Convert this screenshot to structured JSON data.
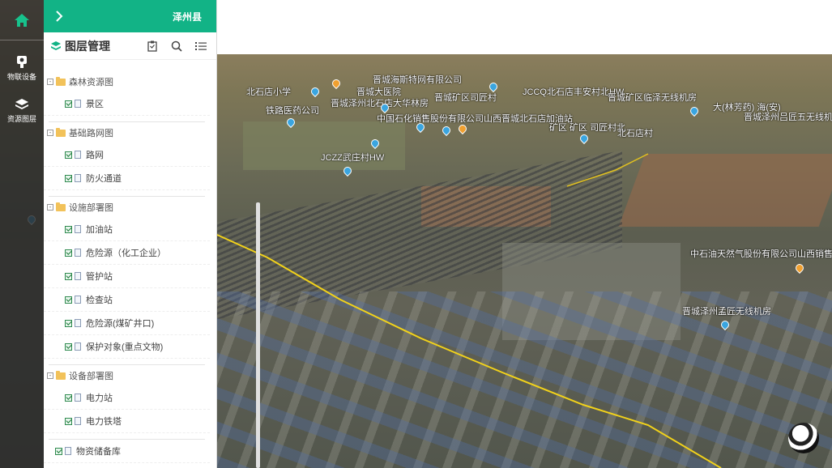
{
  "sidebar": {
    "home_icon": "home-icon",
    "items": [
      {
        "label": "物联设备",
        "icon": "iot-device-icon"
      },
      {
        "label": "资源图层",
        "icon": "layers-icon"
      }
    ]
  },
  "panel": {
    "expand_icon": "chevron-right-icon",
    "county": "泽州县",
    "title": "图层管理",
    "tools": [
      "clipboard-icon",
      "search-icon",
      "list-icon"
    ],
    "groups": [
      {
        "name": "森林资源图",
        "items": [
          "景区"
        ]
      },
      {
        "name": "基础路网图",
        "items": [
          "路网",
          "防火通道"
        ]
      },
      {
        "name": "设施部署图",
        "items": [
          "加油站",
          "危险源（化工企业）",
          "管护站",
          "检查站",
          "危险源(煤矿井口)",
          "保护对象(重点文物)"
        ]
      },
      {
        "name": "设备部署图",
        "items": [
          "电力站",
          "电力铁塔"
        ]
      }
    ],
    "top_level_item": "物资储备库"
  },
  "map": {
    "labels": [
      "北石店小学",
      "晋城泽州北石店大华林房",
      "晋城大医院",
      "JCCQ北石店丰安村北HW",
      "晋城矿区临泽无线机房",
      "铁路医药公司",
      "中国石化销售股份有限公司山西晋城北石店加油站",
      "晋城矿区司匠村",
      "矿区 矿区 司匠村北",
      "北石店村",
      "JCZZ武庄村HW",
      "中石油天然气股份有限公司山西销售",
      "晋城泽州孟匠无线机房",
      "晋城泽州吕匠五无线机房",
      "大(林芳药) 海(安)",
      "晋城海斯特网有限公司"
    ],
    "globe_icon": "globe-icon",
    "colors": {
      "pin": "#3aa5e0",
      "pin_fuel": "#f0a030",
      "route": "#f2d21a",
      "accent": "#12b386"
    }
  }
}
